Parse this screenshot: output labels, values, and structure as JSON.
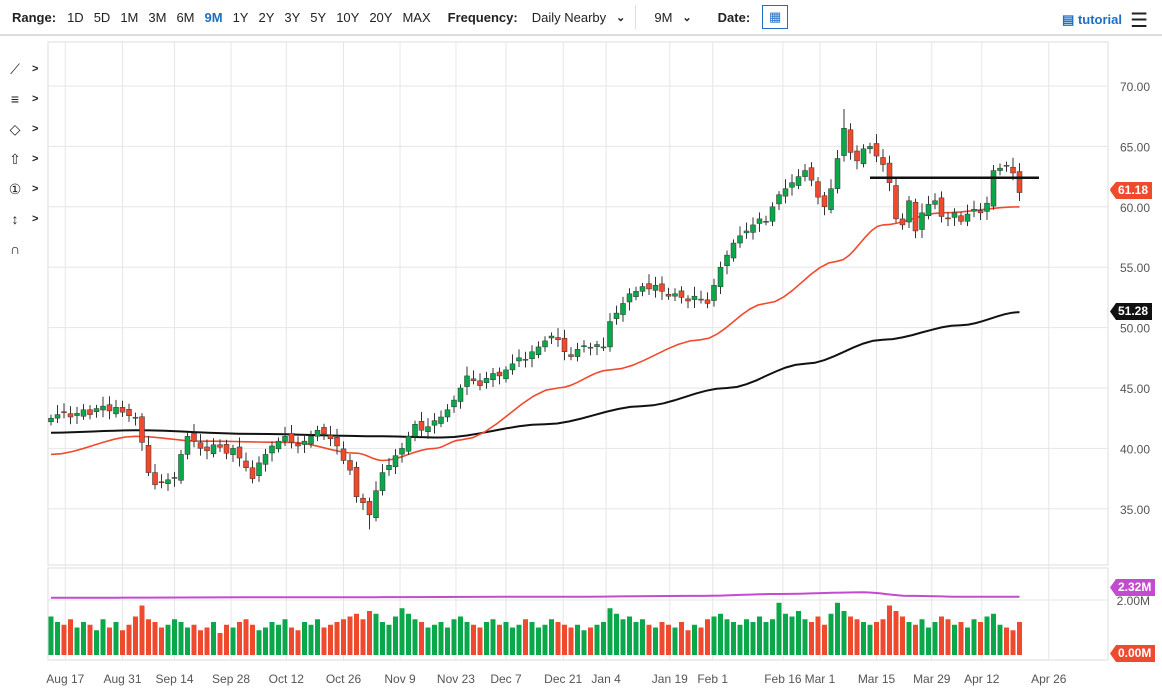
{
  "toolbar": {
    "range_label": "Range:",
    "ranges": [
      "1D",
      "5D",
      "1M",
      "3M",
      "6M",
      "9M",
      "1Y",
      "2Y",
      "3Y",
      "5Y",
      "10Y",
      "20Y",
      "MAX"
    ],
    "active_range": "9M",
    "frequency_label": "Frequency:",
    "frequency": "Daily Nearby",
    "period": "9M",
    "date_label": "Date:",
    "tutorial": "tutorial"
  },
  "tools": [
    "trendline-icon",
    "fib-icon",
    "shape-icon",
    "arrow-icon",
    "number-icon",
    "measure-icon",
    "magnet-icon"
  ],
  "colors": {
    "up": "#0aa84a",
    "down": "#f04a2e",
    "ma50": "#f04a2e",
    "ma200": "#111111",
    "vol_avg": "#c34bd0"
  },
  "tags": {
    "last": "61.18",
    "ma50": "60.00",
    "ma200": "51.28",
    "vol_avg": "2.32M",
    "vol_last": "0.00M"
  },
  "chart_data": {
    "type": "candlestick",
    "ylim": [
      31,
      73
    ],
    "yticks": [
      "70.00",
      "65.00",
      "60.00",
      "55.00",
      "50.00",
      "45.00",
      "40.00",
      "35.00"
    ],
    "ytick_values": [
      70,
      65,
      60,
      55,
      50,
      45,
      40,
      35
    ],
    "vol_ticks": [
      "2.00M"
    ],
    "xticks": [
      {
        "label": "Aug 17",
        "i": 2.2
      },
      {
        "label": "Aug 31",
        "i": 11
      },
      {
        "label": "Sep 14",
        "i": 19
      },
      {
        "label": "Sep 28",
        "i": 27.7
      },
      {
        "label": "Oct 12",
        "i": 36.2
      },
      {
        "label": "Oct 26",
        "i": 45
      },
      {
        "label": "Nov 9",
        "i": 53.7
      },
      {
        "label": "Nov 23",
        "i": 62.3
      },
      {
        "label": "Dec 7",
        "i": 70
      },
      {
        "label": "Dec 21",
        "i": 78.8
      },
      {
        "label": "Jan 4",
        "i": 85.4
      },
      {
        "label": "Jan 19",
        "i": 95.2
      },
      {
        "label": "Feb 1",
        "i": 101.8
      },
      {
        "label": "Feb 16",
        "i": 112.6
      },
      {
        "label": "Mar 1",
        "i": 118.3
      },
      {
        "label": "Mar 15",
        "i": 127
      },
      {
        "label": "Mar 29",
        "i": 135.5
      },
      {
        "label": "Apr 12",
        "i": 143.2
      },
      {
        "label": "Apr 26",
        "i": 153.5
      }
    ],
    "close": [
      42.5,
      42.8,
      43,
      42.6,
      42.9,
      43.2,
      42.8,
      43.3,
      43.5,
      43.1,
      43.4,
      43.0,
      42.7,
      42.5,
      40.5,
      38,
      37,
      37.2,
      37.4,
      37.6,
      39.5,
      41,
      40.6,
      40,
      39.8,
      40.3,
      40.1,
      39.6,
      40,
      39.2,
      38.4,
      37.5,
      38.8,
      39.5,
      40.2,
      40.6,
      41,
      40.5,
      40.2,
      40.6,
      41,
      41.5,
      41.2,
      40.8,
      40.2,
      39,
      38.2,
      36,
      35.5,
      34.5,
      36.5,
      38,
      38.6,
      39.4,
      40,
      41,
      42,
      41.5,
      41.8,
      42.3,
      42.6,
      43.2,
      44,
      45,
      46,
      45.6,
      45.2,
      45.8,
      46.2,
      46,
      46.5,
      47,
      47.5,
      47.3,
      48,
      48.4,
      48.9,
      49.3,
      49,
      48,
      47.6,
      48.2,
      48.5,
      48.3,
      48.6,
      48.4,
      50.5,
      51.2,
      52,
      52.8,
      53,
      53.4,
      53.2,
      53.5,
      53,
      52.6,
      52.8,
      52.5,
      52.2,
      52.6,
      52.3,
      52,
      53.5,
      55,
      56,
      57,
      57.6,
      58,
      58.5,
      59,
      58.8,
      60,
      61,
      61.5,
      62,
      62.5,
      63,
      62.2,
      60.8,
      60,
      61.5,
      64,
      66.5,
      64.5,
      63.8,
      64.8,
      65,
      64.2,
      63.5,
      62,
      59,
      58.5,
      60.5,
      58,
      59.5,
      60.2,
      60.5,
      59.2,
      59,
      59.5,
      58.8,
      59.4,
      59.8,
      59.5,
      60.3,
      63,
      63.2,
      63.4,
      62.8,
      61.18
    ],
    "volume_m": [
      1.4,
      1.2,
      1.1,
      1.3,
      1.0,
      1.2,
      1.1,
      0.9,
      1.3,
      1.0,
      1.2,
      0.9,
      1.1,
      1.4,
      1.8,
      1.3,
      1.2,
      1.0,
      1.1,
      1.3,
      1.2,
      1.0,
      1.1,
      0.9,
      1.0,
      1.2,
      0.8,
      1.1,
      1.0,
      1.2,
      1.3,
      1.1,
      0.9,
      1.0,
      1.2,
      1.1,
      1.3,
      1.0,
      0.9,
      1.2,
      1.1,
      1.3,
      1.0,
      1.1,
      1.2,
      1.3,
      1.4,
      1.5,
      1.3,
      1.6,
      1.5,
      1.2,
      1.1,
      1.4,
      1.7,
      1.5,
      1.3,
      1.2,
      1.0,
      1.1,
      1.2,
      1.0,
      1.3,
      1.4,
      1.2,
      1.1,
      1.0,
      1.2,
      1.3,
      1.1,
      1.2,
      1.0,
      1.1,
      1.3,
      1.2,
      1.0,
      1.1,
      1.3,
      1.2,
      1.1,
      1.0,
      1.1,
      0.9,
      1.0,
      1.1,
      1.2,
      1.7,
      1.5,
      1.3,
      1.4,
      1.2,
      1.3,
      1.1,
      1.0,
      1.2,
      1.1,
      1.0,
      1.2,
      0.9,
      1.1,
      1.0,
      1.3,
      1.4,
      1.5,
      1.3,
      1.2,
      1.1,
      1.3,
      1.2,
      1.4,
      1.2,
      1.3,
      1.9,
      1.5,
      1.4,
      1.6,
      1.3,
      1.2,
      1.4,
      1.1,
      1.5,
      1.9,
      1.6,
      1.4,
      1.3,
      1.2,
      1.1,
      1.2,
      1.3,
      1.8,
      1.6,
      1.4,
      1.2,
      1.1,
      1.3,
      1.0,
      1.2,
      1.4,
      1.3,
      1.1,
      1.2,
      1.0,
      1.3,
      1.2,
      1.4,
      1.5,
      1.1,
      1.0,
      0.9,
      1.2
    ],
    "ma50": [
      [
        0,
        39.5
      ],
      [
        13,
        41
      ],
      [
        23,
        40.6
      ],
      [
        37,
        40.5
      ],
      [
        47,
        39.6
      ],
      [
        51,
        39
      ],
      [
        59,
        40
      ],
      [
        63,
        40.7
      ],
      [
        78,
        45
      ],
      [
        86,
        46.5
      ],
      [
        100,
        49
      ],
      [
        110,
        52
      ],
      [
        121,
        55.5
      ],
      [
        128,
        58.5
      ],
      [
        137,
        59.5
      ],
      [
        149,
        60
      ]
    ],
    "ma200": [
      [
        0,
        41.3
      ],
      [
        13,
        41.5
      ],
      [
        31,
        41.2
      ],
      [
        51,
        41
      ],
      [
        60,
        40.9
      ],
      [
        76,
        42
      ],
      [
        91,
        43.5
      ],
      [
        104,
        45
      ],
      [
        116,
        47
      ],
      [
        128,
        49
      ],
      [
        140,
        50.2
      ],
      [
        149,
        51.28
      ]
    ],
    "vol_avg": [
      [
        0,
        2.08
      ],
      [
        40,
        2.1
      ],
      [
        80,
        2.12
      ],
      [
        100,
        2.15
      ],
      [
        112,
        2.22
      ],
      [
        125,
        2.28
      ],
      [
        132,
        2.15
      ],
      [
        140,
        2.12
      ],
      [
        149,
        2.12
      ]
    ],
    "resistance": {
      "from": 126,
      "to": 152,
      "value": 62.4
    },
    "peak_high": 68.1,
    "trough_low": 33.3
  }
}
